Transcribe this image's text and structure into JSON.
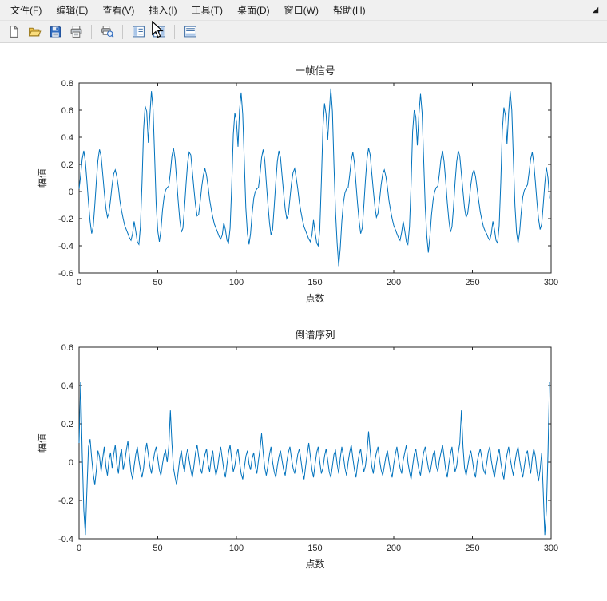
{
  "menubar": {
    "items": [
      {
        "name": "file",
        "label": "文件(F)"
      },
      {
        "name": "edit",
        "label": "编辑(E)"
      },
      {
        "name": "view",
        "label": "查看(V)"
      },
      {
        "name": "insert",
        "label": "插入(I)"
      },
      {
        "name": "tools",
        "label": "工具(T)"
      },
      {
        "name": "desktop",
        "label": "桌面(D)"
      },
      {
        "name": "window",
        "label": "窗口(W)"
      },
      {
        "name": "help",
        "label": "帮助(H)"
      }
    ]
  },
  "toolbar": {
    "buttons": [
      {
        "name": "new-figure",
        "icon": "new-figure-icon"
      },
      {
        "name": "open-file",
        "icon": "open-file-icon"
      },
      {
        "name": "save-figure",
        "icon": "save-figure-icon"
      },
      {
        "name": "print-figure",
        "icon": "print-figure-icon"
      },
      {
        "separator": true
      },
      {
        "name": "print-preview",
        "icon": "print-preview-icon"
      },
      {
        "separator": true
      },
      {
        "name": "figure-palette",
        "icon": "figure-palette-icon"
      },
      {
        "name": "plot-browser",
        "icon": "plot-browser-icon"
      },
      {
        "separator": true
      },
      {
        "name": "property-editor",
        "icon": "property-editor-icon"
      }
    ]
  },
  "colors": {
    "line": "#0072bd",
    "axis": "#262626",
    "chrome": "#f0f0f0",
    "canvas": "#ffffff"
  },
  "chart_data": [
    {
      "type": "line",
      "title": "一帧信号",
      "xlabel": "点数",
      "ylabel": "幅值",
      "xlim": [
        0,
        300
      ],
      "ylim": [
        -0.6,
        0.8
      ],
      "xticks": [
        0,
        50,
        100,
        150,
        200,
        250,
        300
      ],
      "yticks": [
        -0.6,
        -0.4,
        -0.2,
        0,
        0.2,
        0.4,
        0.6,
        0.8
      ],
      "grid": false,
      "values": [
        0.02,
        0.12,
        0.24,
        0.3,
        0.22,
        0.08,
        -0.08,
        -0.22,
        -0.31,
        -0.26,
        -0.1,
        0.08,
        0.23,
        0.31,
        0.26,
        0.13,
        0.0,
        -0.12,
        -0.19,
        -0.16,
        -0.06,
        0.05,
        0.13,
        0.16,
        0.11,
        0.03,
        -0.07,
        -0.14,
        -0.2,
        -0.25,
        -0.28,
        -0.31,
        -0.34,
        -0.36,
        -0.31,
        -0.22,
        -0.29,
        -0.37,
        -0.39,
        -0.26,
        0.06,
        0.46,
        0.63,
        0.59,
        0.36,
        0.56,
        0.74,
        0.61,
        0.26,
        -0.09,
        -0.29,
        -0.37,
        -0.29,
        -0.14,
        -0.04,
        0.01,
        0.03,
        0.04,
        0.14,
        0.26,
        0.32,
        0.24,
        0.09,
        -0.07,
        -0.21,
        -0.3,
        -0.27,
        -0.12,
        0.06,
        0.21,
        0.29,
        0.27,
        0.15,
        0.02,
        -0.1,
        -0.18,
        -0.17,
        -0.07,
        0.04,
        0.12,
        0.17,
        0.12,
        0.04,
        -0.06,
        -0.13,
        -0.19,
        -0.24,
        -0.27,
        -0.3,
        -0.33,
        -0.35,
        -0.32,
        -0.23,
        -0.28,
        -0.36,
        -0.38,
        -0.27,
        0.04,
        0.42,
        0.58,
        0.52,
        0.33,
        0.6,
        0.73,
        0.57,
        0.22,
        -0.12,
        -0.31,
        -0.39,
        -0.31,
        -0.16,
        -0.05,
        0.0,
        0.02,
        0.03,
        0.13,
        0.25,
        0.31,
        0.23,
        0.07,
        -0.09,
        -0.23,
        -0.32,
        -0.28,
        -0.11,
        0.07,
        0.22,
        0.3,
        0.25,
        0.12,
        -0.01,
        -0.13,
        -0.2,
        -0.17,
        -0.05,
        0.06,
        0.14,
        0.17,
        0.1,
        0.02,
        -0.08,
        -0.15,
        -0.21,
        -0.26,
        -0.29,
        -0.32,
        -0.35,
        -0.37,
        -0.32,
        -0.21,
        -0.3,
        -0.38,
        -0.4,
        -0.28,
        0.08,
        0.48,
        0.65,
        0.57,
        0.38,
        0.58,
        0.76,
        0.59,
        0.2,
        -0.15,
        -0.38,
        -0.55,
        -0.42,
        -0.22,
        -0.08,
        -0.01,
        0.02,
        0.03,
        0.12,
        0.23,
        0.29,
        0.21,
        0.06,
        -0.09,
        -0.22,
        -0.31,
        -0.27,
        -0.1,
        0.08,
        0.24,
        0.32,
        0.27,
        0.14,
        0.01,
        -0.11,
        -0.19,
        -0.16,
        -0.06,
        0.05,
        0.13,
        0.16,
        0.11,
        0.03,
        -0.07,
        -0.14,
        -0.2,
        -0.25,
        -0.28,
        -0.31,
        -0.34,
        -0.36,
        -0.3,
        -0.22,
        -0.29,
        -0.37,
        -0.39,
        -0.26,
        0.05,
        0.44,
        0.6,
        0.55,
        0.34,
        0.57,
        0.72,
        0.58,
        0.24,
        -0.11,
        -0.33,
        -0.45,
        -0.33,
        -0.17,
        -0.06,
        0.0,
        0.03,
        0.04,
        0.13,
        0.24,
        0.3,
        0.22,
        0.08,
        -0.08,
        -0.21,
        -0.3,
        -0.26,
        -0.11,
        0.07,
        0.22,
        0.3,
        0.26,
        0.13,
        0.0,
        -0.12,
        -0.19,
        -0.16,
        -0.06,
        0.05,
        0.13,
        0.16,
        0.11,
        0.02,
        -0.07,
        -0.15,
        -0.21,
        -0.26,
        -0.29,
        -0.31,
        -0.34,
        -0.36,
        -0.31,
        -0.22,
        -0.28,
        -0.36,
        -0.38,
        -0.25,
        0.07,
        0.45,
        0.62,
        0.56,
        0.35,
        0.58,
        0.74,
        0.6,
        0.25,
        -0.1,
        -0.3,
        -0.38,
        -0.3,
        -0.15,
        -0.04,
        0.01,
        0.03,
        0.05,
        0.14,
        0.24,
        0.29,
        0.21,
        0.07,
        -0.08,
        -0.2,
        -0.28,
        -0.24,
        -0.1,
        0.06,
        0.18,
        0.1,
        -0.05
      ]
    },
    {
      "type": "line",
      "title": "倒谱序列",
      "xlabel": "点数",
      "ylabel": "幅值",
      "xlim": [
        0,
        300
      ],
      "ylim": [
        -0.4,
        0.6
      ],
      "xticks": [
        0,
        50,
        100,
        150,
        200,
        250,
        300
      ],
      "yticks": [
        -0.4,
        -0.2,
        0,
        0.2,
        0.4,
        0.6
      ],
      "grid": false,
      "values": [
        0.1,
        0.42,
        0.05,
        -0.25,
        -0.38,
        -0.15,
        0.08,
        0.12,
        0.02,
        -0.06,
        -0.12,
        -0.04,
        0.06,
        0.03,
        -0.05,
        0.02,
        0.08,
        -0.02,
        -0.07,
        0.01,
        0.05,
        -0.03,
        0.04,
        0.09,
        -0.01,
        -0.06,
        0.03,
        0.07,
        -0.04,
        0.0,
        0.06,
        0.11,
        0.03,
        -0.05,
        -0.09,
        -0.02,
        0.04,
        0.08,
        0.01,
        -0.04,
        -0.08,
        -0.03,
        0.05,
        0.1,
        0.04,
        -0.02,
        -0.06,
        0.0,
        0.05,
        0.08,
        0.02,
        -0.04,
        -0.07,
        -0.01,
        0.04,
        0.06,
        0.0,
        0.08,
        0.27,
        0.1,
        -0.03,
        -0.08,
        -0.12,
        -0.05,
        0.02,
        0.06,
        -0.01,
        -0.05,
        0.03,
        0.07,
        0.01,
        -0.04,
        -0.08,
        -0.02,
        0.05,
        0.09,
        0.03,
        -0.03,
        -0.06,
        0.0,
        0.04,
        0.07,
        -0.01,
        -0.05,
        0.02,
        0.06,
        -0.02,
        -0.07,
        -0.03,
        0.03,
        0.08,
        0.02,
        -0.04,
        -0.08,
        -0.01,
        0.05,
        0.09,
        0.01,
        -0.05,
        -0.02,
        0.04,
        0.07,
        0.0,
        -0.06,
        -0.09,
        -0.03,
        0.03,
        0.06,
        -0.01,
        -0.04,
        0.02,
        0.05,
        -0.02,
        -0.06,
        0.01,
        0.07,
        0.15,
        0.05,
        -0.03,
        -0.07,
        -0.02,
        0.04,
        0.08,
        0.0,
        -0.05,
        -0.08,
        -0.02,
        0.03,
        0.06,
        0.01,
        -0.04,
        -0.07,
        0.0,
        0.05,
        0.08,
        0.02,
        -0.03,
        -0.06,
        -0.01,
        0.04,
        0.07,
        0.01,
        -0.05,
        -0.09,
        -0.02,
        0.04,
        0.1,
        0.03,
        -0.04,
        -0.08,
        -0.01,
        0.05,
        0.08,
        0.0,
        -0.06,
        -0.03,
        0.03,
        0.07,
        0.01,
        -0.05,
        -0.08,
        -0.02,
        0.04,
        0.06,
        -0.01,
        -0.06,
        0.02,
        0.08,
        0.03,
        -0.03,
        -0.07,
        0.0,
        0.05,
        0.09,
        0.02,
        -0.04,
        -0.08,
        -0.01,
        0.04,
        0.07,
        0.0,
        -0.05,
        -0.02,
        0.05,
        0.16,
        0.06,
        -0.02,
        -0.06,
        0.01,
        0.05,
        0.08,
        0.01,
        -0.04,
        -0.07,
        -0.02,
        0.03,
        0.06,
        0.0,
        -0.05,
        -0.08,
        -0.01,
        0.04,
        0.08,
        0.02,
        -0.03,
        -0.06,
        0.01,
        0.05,
        0.09,
        0.0,
        -0.05,
        -0.09,
        -0.02,
        0.04,
        0.07,
        0.01,
        -0.04,
        -0.07,
        0.0,
        0.05,
        0.08,
        0.02,
        -0.03,
        -0.06,
        -0.01,
        0.04,
        0.06,
        -0.02,
        -0.05,
        0.01,
        0.05,
        0.09,
        0.03,
        -0.04,
        -0.08,
        -0.01,
        0.04,
        0.08,
        0.0,
        -0.05,
        -0.02,
        0.05,
        0.1,
        0.27,
        0.08,
        -0.03,
        -0.07,
        -0.02,
        0.03,
        0.06,
        0.01,
        -0.05,
        -0.08,
        0.0,
        0.04,
        0.07,
        0.02,
        -0.04,
        -0.06,
        -0.01,
        0.05,
        0.08,
        0.01,
        -0.04,
        -0.08,
        -0.02,
        0.03,
        0.07,
        0.0,
        -0.05,
        -0.09,
        -0.01,
        0.04,
        0.08,
        0.02,
        -0.03,
        -0.07,
        0.0,
        0.05,
        0.08,
        0.01,
        -0.04,
        -0.08,
        -0.02,
        0.04,
        0.06,
        -0.01,
        -0.06,
        0.02,
        0.07,
        0.03,
        -0.05,
        -0.1,
        -0.04,
        0.05,
        -0.15,
        -0.38,
        -0.25,
        0.05,
        0.42
      ]
    }
  ]
}
